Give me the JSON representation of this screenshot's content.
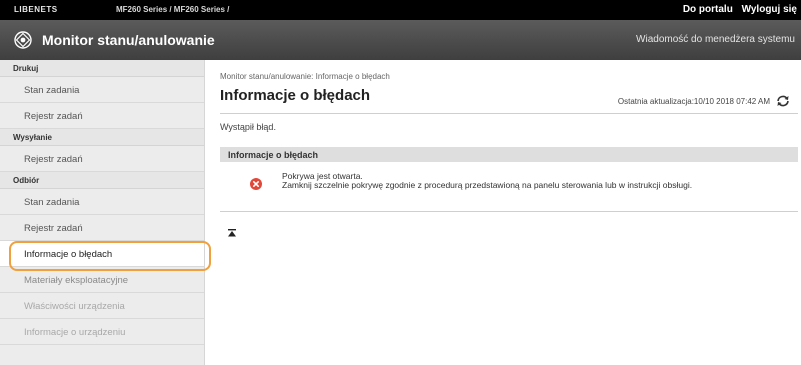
{
  "topbar": {
    "brand": "LIBENETS",
    "model": "MF260 Series / MF260 Series /",
    "portal_link": "Do portalu",
    "logout_link": "Wyloguj się"
  },
  "header": {
    "title": "Monitor stanu/anulowanie",
    "message_link": "Wiadomość do menedżera systemu"
  },
  "sidebar": {
    "sections": [
      {
        "heading": "Drukuj",
        "items": [
          "Stan zadania",
          "Rejestr zadań"
        ]
      },
      {
        "heading": "Wysyłanie",
        "items": [
          "Rejestr zadań"
        ]
      },
      {
        "heading": "Odbiór",
        "items": [
          "Stan zadania",
          "Rejestr zadań"
        ]
      }
    ],
    "extra_items": [
      "Informacje o błędach",
      "Materiały eksploatacyjne",
      "Właściwości urządzenia",
      "Informacje o urządzeniu"
    ],
    "active_item": "Informacje o błędach"
  },
  "main": {
    "breadcrumb": "Monitor stanu/anulowanie: Informacje o błędach",
    "title": "Informacje o błędach",
    "last_update": "Ostatnia aktualizacja:10/10 2018 07:42 AM",
    "error_status": "Wystąpił błąd.",
    "section_title": "Informacje o błędach",
    "error_title": "Pokrywa jest otwarta.",
    "error_detail": "Zamknij szczelnie pokrywę zgodnie z procedurą przedstawioną na panelu sterowania lub w instrukcji obsługi."
  },
  "colors": {
    "highlight": "#f0a03c",
    "error": "#e2483a",
    "header": "#4a4a4a"
  },
  "icons": [
    "canon-logo-icon",
    "refresh-icon",
    "error-icon",
    "back-to-top-icon"
  ]
}
